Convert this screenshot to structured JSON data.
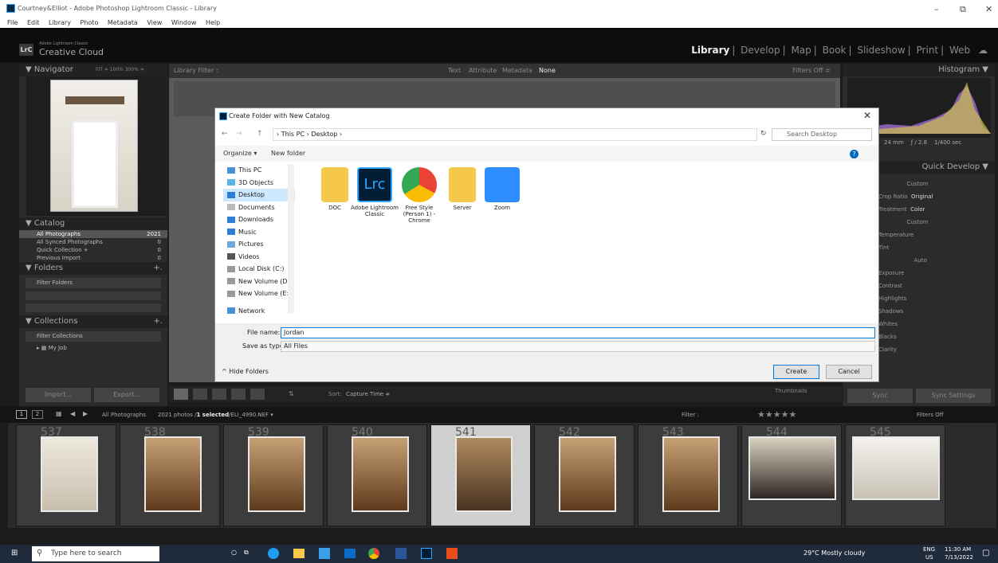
{
  "window": {
    "title": "Courtney&Elliot - Adobe Photoshop Lightroom Classic - Library"
  },
  "menu": [
    "File",
    "Edit",
    "Library",
    "Photo",
    "Metadata",
    "View",
    "Window",
    "Help"
  ],
  "brand": {
    "badge": "LrC",
    "line1": "Adobe Lightroom Classic",
    "line2": "Creative Cloud"
  },
  "modules": [
    "Library",
    "Develop",
    "Map",
    "Book",
    "Slideshow",
    "Print",
    "Web"
  ],
  "navigator": {
    "title": "Navigator",
    "zoom": "FIT ≑  100%  300% ≑"
  },
  "catalog": {
    "title": "Catalog",
    "items": [
      {
        "label": "All Photographs",
        "count": "2021"
      },
      {
        "label": "All Synced Photographs",
        "count": "0"
      },
      {
        "label": "Quick Collection +",
        "count": "0"
      },
      {
        "label": "Previous Import",
        "count": "0"
      }
    ]
  },
  "folders": {
    "title": "Folders",
    "filter": "Filter Folders"
  },
  "collections": {
    "title": "Collections",
    "filter": "Filter Collections",
    "item": "My Job"
  },
  "library_filter": {
    "label": "Library Filter :",
    "tabs": [
      "Text",
      "Attribute",
      "Metadata",
      "None"
    ],
    "filters_off": "Filters Off ≑"
  },
  "right": {
    "histogram": "Histogram",
    "lens": "24 mm",
    "fstop": "ƒ / 2.8",
    "shutter": "1/400 sec",
    "quick_develop": "Quick Develop",
    "custom": "Custom",
    "crop_label": "Crop Ratio",
    "crop_value": "Original",
    "treat_label": "Treatment",
    "treat_value": "Color",
    "wb_value": "Custom",
    "temp": "Temperature",
    "tint": "Tint",
    "auto": "Auto",
    "rows": [
      "Exposure",
      "Contrast",
      "Highlights",
      "Shadows",
      "Whites",
      "Blacks",
      "Clarity"
    ]
  },
  "toolbar": {
    "sort": "Sort:",
    "sort_value": "Capture Time ≑",
    "thumbnails": "Thumbnails",
    "sync": "Sync",
    "sync_settings": "Sync Settings",
    "import": "Import...",
    "export": "Export..."
  },
  "filmstrip": {
    "source": "All Photographs",
    "info_a": "2021 photos /",
    "info_b": "1 selected",
    "info_c": "/ELI_4990.NEF ▾",
    "filter": "Filter :",
    "filters_off": "Filters Off",
    "numbers": [
      "537",
      "538",
      "539",
      "540",
      "541",
      "542",
      "543",
      "544",
      "545"
    ]
  },
  "dialog": {
    "title": "Create Folder with New Catalog",
    "path": [
      "This PC",
      "Desktop"
    ],
    "search": "Search Desktop",
    "organize": "Organize ▾",
    "new_folder": "New folder",
    "tree": [
      "This PC",
      "3D Objects",
      "Desktop",
      "Documents",
      "Downloads",
      "Music",
      "Pictures",
      "Videos",
      "Local Disk (C:)",
      "New Volume (D:",
      "New Volume (E:)",
      "Network"
    ],
    "files": [
      {
        "name": "DOC"
      },
      {
        "name": "Adobe Lightroom Classic"
      },
      {
        "name": "Free Style (Person 1) - Chrome"
      },
      {
        "name": "Server"
      },
      {
        "name": "Zoom"
      }
    ],
    "lrc_text": "Lrc",
    "filename_label": "File name:",
    "filename_value": "Jordan",
    "savetype_label": "Save as type:",
    "savetype_value": "All Files",
    "hide_folders": "Hide Folders",
    "create": "Create",
    "cancel": "Cancel"
  },
  "taskbar": {
    "search": "Type here to search",
    "weather": "29°C  Mostly cloudy",
    "lang": "ENG",
    "region": "US",
    "time": "11:30 AM",
    "date": "7/13/2022"
  },
  "colors": {
    "accent": "#31a8ff",
    "lrc_bg": "#001e36",
    "folder": "#f5c84c",
    "zoom": "#2d8cff"
  }
}
